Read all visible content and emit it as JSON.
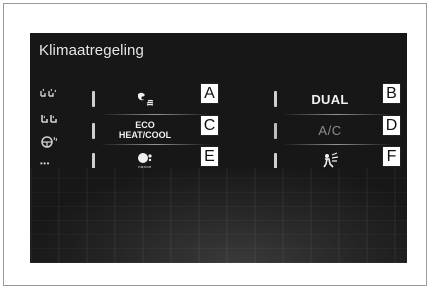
{
  "screen": {
    "title": "Klimaatregeling"
  },
  "sidebar": {
    "items": [
      {
        "icon": "seat-airflow-icon"
      },
      {
        "icon": "seat-heater-icon"
      },
      {
        "icon": "steering-heater-icon"
      },
      {
        "icon": "more-icon",
        "label": "•••"
      }
    ]
  },
  "buttons": {
    "a": {
      "icon": "fan-speed-icon",
      "callout": "A"
    },
    "b": {
      "label": "DUAL",
      "callout": "B"
    },
    "c": {
      "label_line1": "ECO",
      "label_line2": "HEAT/COOL",
      "callout": "C"
    },
    "d": {
      "label": "A/C",
      "callout": "D"
    },
    "e": {
      "icon": "nanoe-icon",
      "icon_text": "nanoe",
      "callout": "E"
    },
    "f": {
      "icon": "windshield-airflow-icon",
      "callout": "F"
    }
  },
  "colors": {
    "screen_bg": "#171717",
    "text": "#f0f0f0",
    "inactive_text": "#8c8c8c",
    "callout_bg": "#ffffff"
  }
}
